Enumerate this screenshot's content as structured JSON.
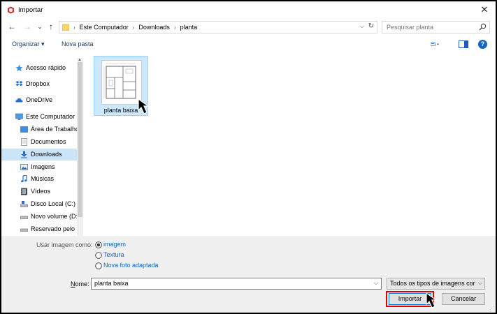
{
  "window": {
    "title": "Importar",
    "close_symbol": "✕"
  },
  "nav": {
    "back": "←",
    "forward": "→",
    "recent": "⌄",
    "up": "↑",
    "breadcrumbs": [
      "Este Computador",
      "Downloads",
      "planta"
    ],
    "separator": "›",
    "search_placeholder": "Pesquisar planta"
  },
  "toolbar": {
    "organize": "Organizar ▾",
    "new_folder": "Nova pasta"
  },
  "sidebar": {
    "items": [
      {
        "label": "Acesso rápido",
        "icon": "star-icon"
      },
      {
        "label": "Dropbox",
        "icon": "dropbox-icon"
      },
      {
        "label": "OneDrive",
        "icon": "cloud-icon"
      },
      {
        "label": "Este Computador",
        "icon": "computer-icon"
      },
      {
        "label": "Área de Trabalho",
        "icon": "desktop-icon"
      },
      {
        "label": "Documentos",
        "icon": "document-icon"
      },
      {
        "label": "Downloads",
        "icon": "download-icon",
        "selected": true
      },
      {
        "label": "Imagens",
        "icon": "image-icon"
      },
      {
        "label": "Músicas",
        "icon": "music-icon"
      },
      {
        "label": "Vídeos",
        "icon": "video-icon"
      },
      {
        "label": "Disco Local (C:)",
        "icon": "drive-icon"
      },
      {
        "label": "Novo volume (D:)",
        "icon": "drive-icon"
      },
      {
        "label": "Reservado pelo Sistema",
        "icon": "drive-icon"
      }
    ]
  },
  "files": [
    {
      "name": "planta baixa",
      "selected": true
    }
  ],
  "options": {
    "label": "Usar imagem como:",
    "choices": [
      {
        "label": "imagem",
        "checked": true
      },
      {
        "label": "Textura",
        "checked": false
      },
      {
        "label": "Nova foto adaptada",
        "checked": false
      }
    ]
  },
  "filename": {
    "label": "Nome:",
    "value": "planta baixa"
  },
  "filetype": {
    "value": "Todos os tipos de imagens compatíveis"
  },
  "buttons": {
    "import": "Importar",
    "cancel": "Cancelar"
  },
  "colors": {
    "accent": "#1565c0",
    "selection": "#cce8ff",
    "highlight": "#e00000"
  }
}
